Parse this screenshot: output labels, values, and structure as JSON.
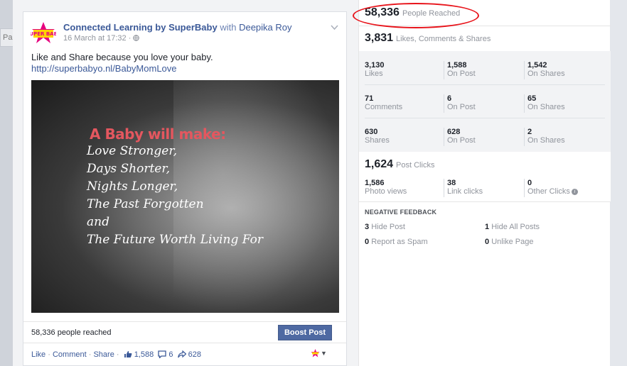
{
  "background": {
    "left_tab_label": "Pa"
  },
  "post": {
    "page_name": "Connected Learning by SuperBaby",
    "with_text": "with",
    "with_name": "Deepika Roy",
    "timestamp": "16 March at 17:32 ·",
    "text": "Like and Share because you love your baby.",
    "link": "http://superbabyo.nl/BabyMomLove",
    "image": {
      "title": "A Baby will make:",
      "lines": [
        "Love Stronger,",
        "Days Shorter,",
        "Nights Longer,",
        "The Past Forgotten",
        "and",
        "The Future Worth Living For"
      ]
    },
    "reached_text": "58,336 people reached",
    "boost_label": "Boost Post",
    "actions": {
      "like": "Like",
      "comment": "Comment",
      "share": "Share",
      "likes_count": "1,588",
      "comments_count": "6",
      "shares_count": "628"
    },
    "avatar_text": "SUPER BABY"
  },
  "stats": {
    "reach": {
      "value": "58,336",
      "label": "People Reached"
    },
    "engagement": {
      "value": "3,831",
      "label": "Likes, Comments & Shares"
    },
    "grid": [
      [
        {
          "num": "3,130",
          "lbl": "Likes"
        },
        {
          "num": "1,588",
          "lbl": "On Post"
        },
        {
          "num": "1,542",
          "lbl": "On Shares"
        }
      ],
      [
        {
          "num": "71",
          "lbl": "Comments"
        },
        {
          "num": "6",
          "lbl": "On Post"
        },
        {
          "num": "65",
          "lbl": "On Shares"
        }
      ],
      [
        {
          "num": "630",
          "lbl": "Shares"
        },
        {
          "num": "628",
          "lbl": "On Post"
        },
        {
          "num": "2",
          "lbl": "On Shares"
        }
      ]
    ],
    "post_clicks": {
      "value": "1,624",
      "label": "Post Clicks"
    },
    "clicks": [
      {
        "num": "1,586",
        "lbl": "Photo views"
      },
      {
        "num": "38",
        "lbl": "Link clicks"
      },
      {
        "num": "0",
        "lbl": "Other Clicks"
      }
    ],
    "negative": {
      "title": "NEGATIVE FEEDBACK",
      "items": [
        {
          "num": "3",
          "lbl": "Hide Post"
        },
        {
          "num": "1",
          "lbl": "Hide All Posts"
        },
        {
          "num": "0",
          "lbl": "Report as Spam"
        },
        {
          "num": "0",
          "lbl": "Unlike Page"
        }
      ]
    }
  },
  "colors": {
    "link": "#3b5998",
    "highlight": "#e8141b",
    "button": "#4e69a2"
  }
}
